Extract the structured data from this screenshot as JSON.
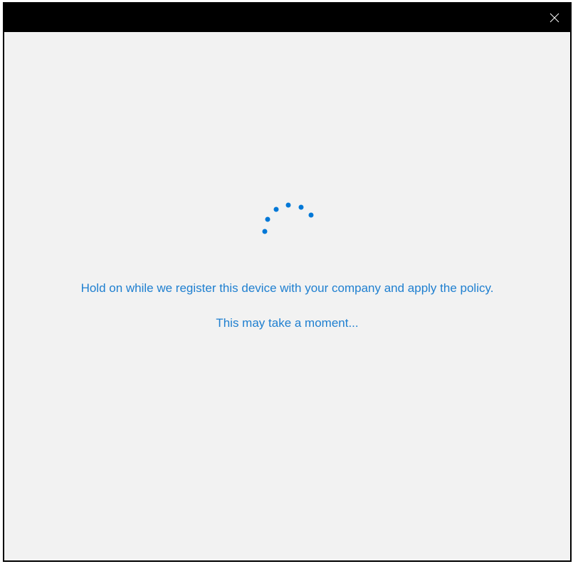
{
  "window": {
    "close_icon": "close-icon"
  },
  "main": {
    "spinner_icon": "loading-spinner-icon",
    "message": "Hold on while we register this device with your company and apply the policy.",
    "submessage": "This may take a moment..."
  },
  "colors": {
    "accent": "#0078d7",
    "text": "#1e7fd0",
    "background": "#f2f2f2",
    "title_bar": "#000000"
  }
}
